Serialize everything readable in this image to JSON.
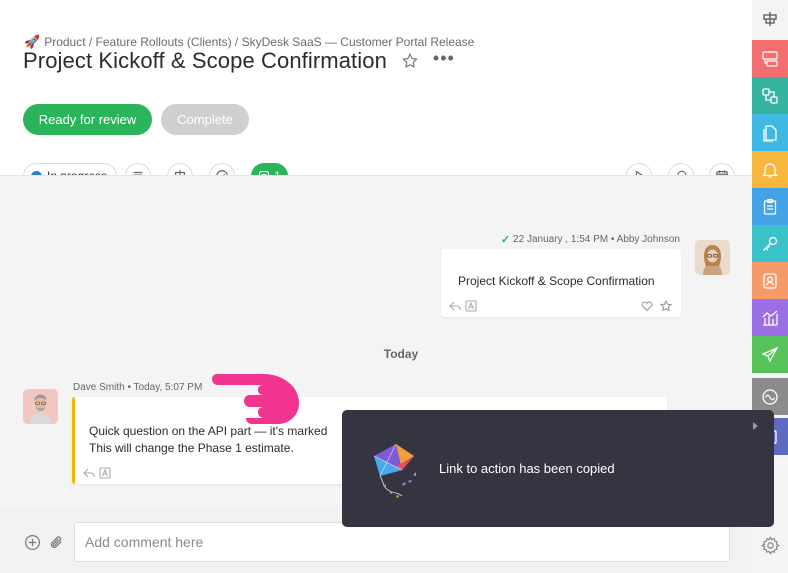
{
  "breadcrumb": {
    "text": "Product / Feature Rollouts (Clients) / SkyDesk SaaS — Customer Portal Release"
  },
  "task": {
    "title": "Project Kickoff & Scope Confirmation"
  },
  "actions": {
    "ready_label": "Ready for review",
    "complete_label": "Complete"
  },
  "toolbar": {
    "status_label": "In progress",
    "status_color": "#2f7bd5",
    "comments_count": "1"
  },
  "chat": {
    "messages": [
      {
        "meta": "22 January , 1:54 PM • Abby Johnson",
        "text": "Project Kickoff & Scope Confirmation"
      },
      {
        "meta": "Dave Smith • Today, 5:07 PM",
        "line1": "Quick question on the API part — it's marked",
        "line2": "This will change the Phase 1 estimate."
      }
    ],
    "day_separator": "Today"
  },
  "comment": {
    "placeholder": "Add comment here"
  },
  "toast": {
    "text": "Link to action has been copied"
  },
  "rail": {
    "items": [
      {
        "icon": "split-icon",
        "color": "#f4f4f4"
      },
      {
        "icon": "board-icon",
        "color": "#f36f6f"
      },
      {
        "icon": "flow-icon",
        "color": "#36b49f"
      },
      {
        "icon": "docs-icon",
        "color": "#3fb9e3"
      },
      {
        "icon": "bell-icon",
        "color": "#f6b73c"
      },
      {
        "icon": "clipboard-icon",
        "color": "#43a3e6"
      },
      {
        "icon": "key-icon",
        "color": "#3bc1c8"
      },
      {
        "icon": "contact-icon",
        "color": "#f79a6a"
      },
      {
        "icon": "chart-icon",
        "color": "#9b6ee6"
      },
      {
        "icon": "send-icon",
        "color": "#56c25a"
      },
      {
        "icon": "wave-icon",
        "color": "#8b8b8b"
      },
      {
        "icon": "panel-icon",
        "color": "#5c6bc0"
      }
    ]
  }
}
